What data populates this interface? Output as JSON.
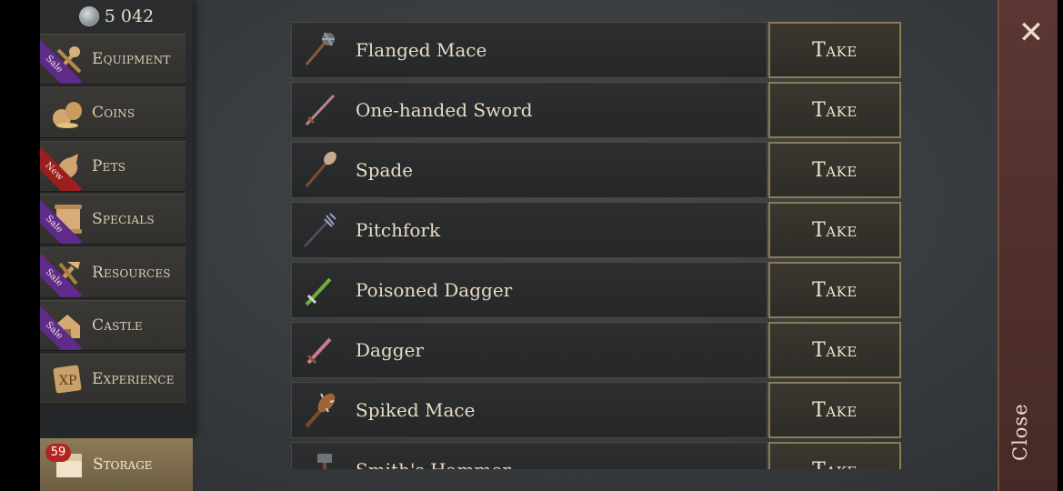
{
  "currency": {
    "amount": "5 042",
    "icon": "silver-coin-icon"
  },
  "sidebar": {
    "items": [
      {
        "label": "Equipment",
        "icon": "weapons-icon",
        "ribbon": "Sale",
        "ribbon_type": "sale"
      },
      {
        "label": "Coins",
        "icon": "coin-bags-icon",
        "ribbon": "",
        "ribbon_type": ""
      },
      {
        "label": "Pets",
        "icon": "pets-icon",
        "ribbon": "New",
        "ribbon_type": "new"
      },
      {
        "label": "Specials",
        "icon": "scroll-icon",
        "ribbon": "Sale",
        "ribbon_type": "sale"
      },
      {
        "label": "Resources",
        "icon": "tools-icon",
        "ribbon": "Sale",
        "ribbon_type": "sale"
      },
      {
        "label": "Castle",
        "icon": "castle-icon",
        "ribbon": "Sale",
        "ribbon_type": "sale"
      },
      {
        "label": "Experience",
        "icon": "xp-book-icon",
        "ribbon": "",
        "ribbon_type": ""
      }
    ],
    "storage": {
      "label": "Storage",
      "count": "59",
      "icon": "chest-icon"
    }
  },
  "items": [
    {
      "name": "Flanged Mace",
      "icon": "flanged-mace-icon",
      "action": "Take"
    },
    {
      "name": "One-handed Sword",
      "icon": "sword-icon",
      "action": "Take"
    },
    {
      "name": "Spade",
      "icon": "spade-icon",
      "action": "Take"
    },
    {
      "name": "Pitchfork",
      "icon": "pitchfork-icon",
      "action": "Take"
    },
    {
      "name": "Poisoned Dagger",
      "icon": "poisoned-dagger-icon",
      "action": "Take"
    },
    {
      "name": "Dagger",
      "icon": "dagger-icon",
      "action": "Take"
    },
    {
      "name": "Spiked Mace",
      "icon": "spiked-mace-icon",
      "action": "Take"
    },
    {
      "name": "Smith's Hammer",
      "icon": "hammer-icon",
      "action": "Take"
    }
  ],
  "close": {
    "label": "Close",
    "icon": "close-icon"
  },
  "colors": {
    "accent_gold": "#8d7a54",
    "sale_ribbon": "#5f2a8a",
    "new_ribbon": "#9c1f1f",
    "badge_red": "#b3241e"
  }
}
